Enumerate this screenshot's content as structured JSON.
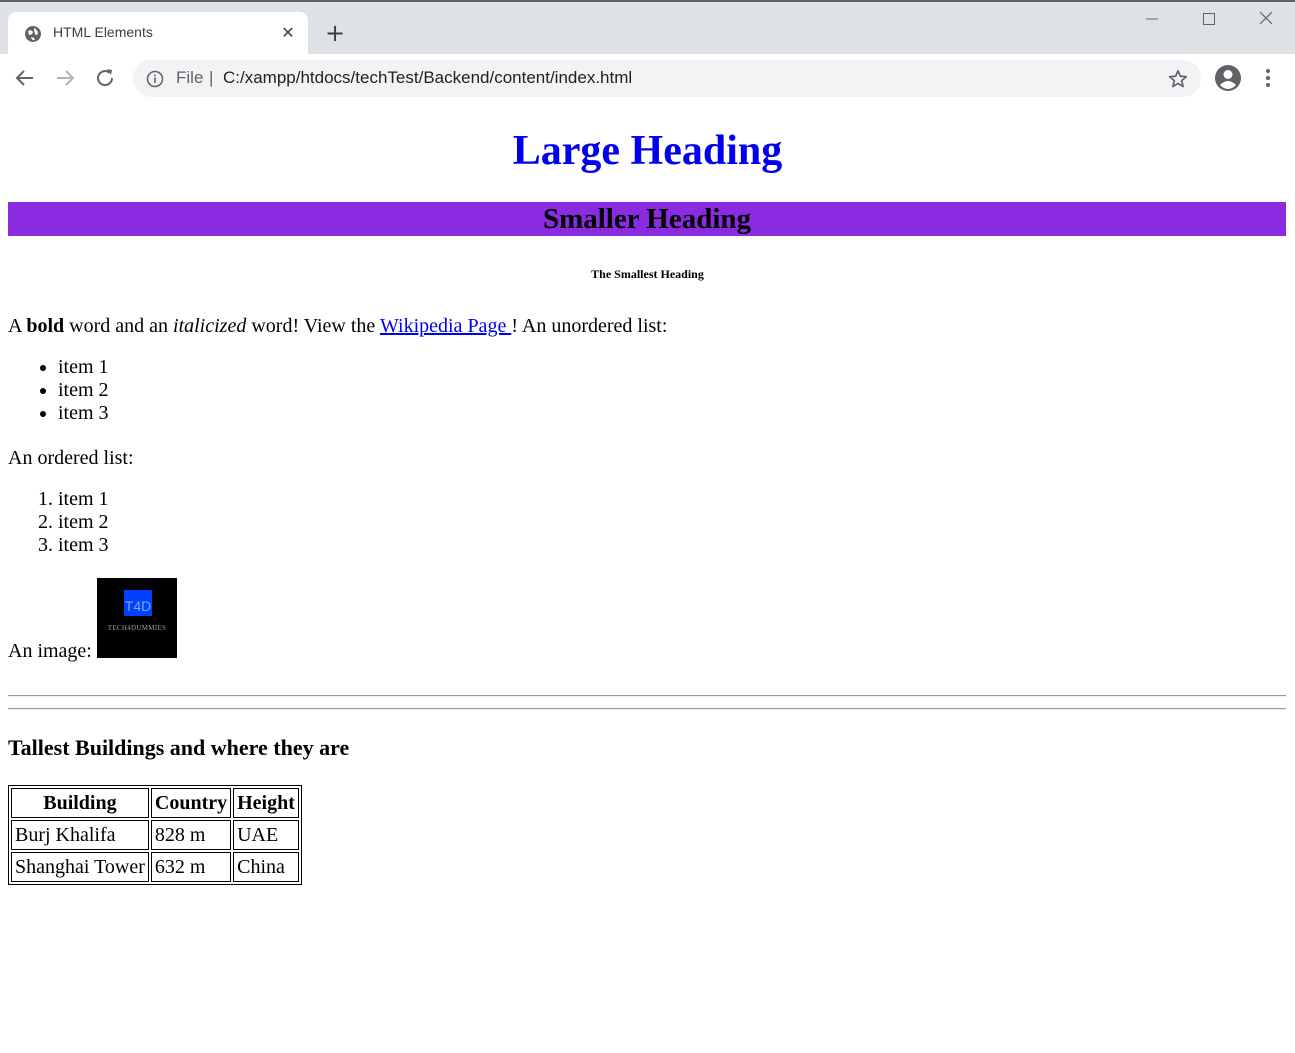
{
  "browser": {
    "tab_title": "HTML Elements",
    "new_tab_label": "+",
    "close_tab_label": "✕",
    "omnibox_scheme": "File",
    "omnibox_separator": "|",
    "url": "C:/xampp/htdocs/techTest/Backend/content/index.html"
  },
  "page": {
    "large_heading": "Large Heading",
    "smaller_heading": "Smaller Heading",
    "smaller_heading_bg": "#8a2be2",
    "smallest_heading": "The Smallest Heading",
    "paragraph": {
      "part1": "A ",
      "bold": "bold",
      "part2": " word and an ",
      "italic": "italicized",
      "part3": " word! View the ",
      "link": "Wikipedia Page ",
      "part4": "! An unordered list:"
    },
    "unordered_list": [
      "item 1",
      "item 2",
      "item 3"
    ],
    "ordered_label": "An ordered list:",
    "ordered_list": [
      "item 1",
      "item 2",
      "item 3"
    ],
    "image_label": "An image:",
    "image_logo_text": "T4D",
    "image_logo_subtext": "TECH4DUMMIES",
    "table_heading": "Tallest Buildings and where they are",
    "table": {
      "headers": [
        "Building",
        "Country",
        "Height"
      ],
      "rows": [
        [
          "Burj Khalifa",
          "828 m",
          "UAE"
        ],
        [
          "Shanghai Tower",
          "632 m",
          "China"
        ]
      ]
    }
  }
}
